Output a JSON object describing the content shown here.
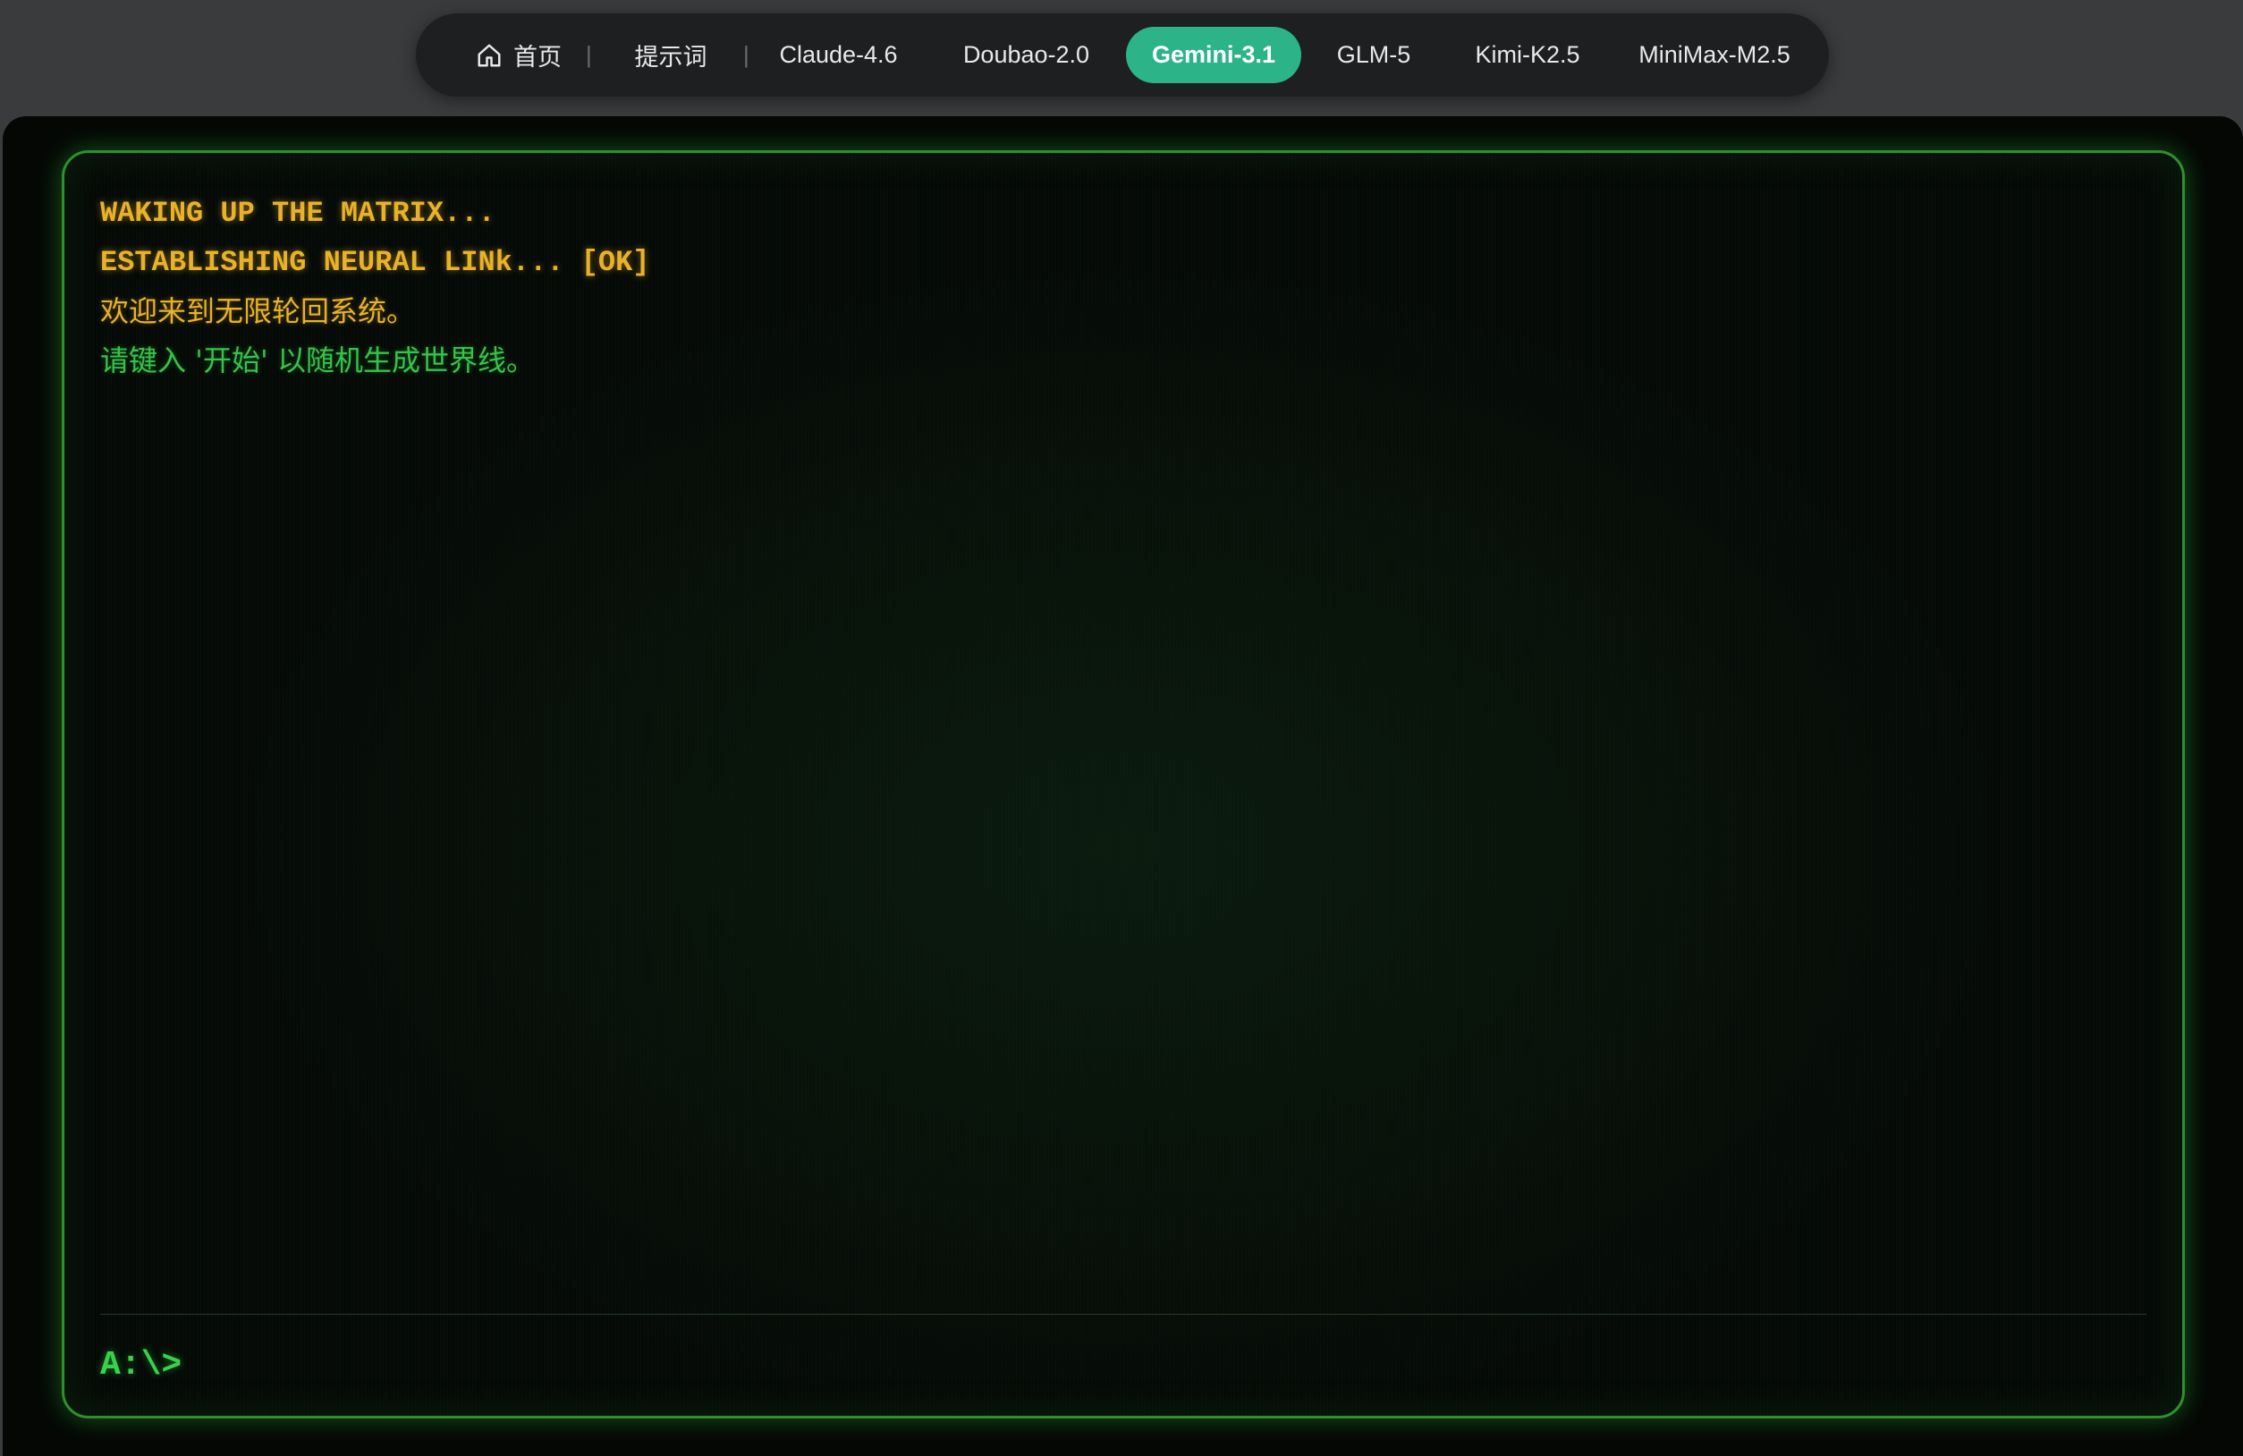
{
  "nav": {
    "home_label": "首页",
    "separator": "|",
    "prompts_label": "提示词",
    "tabs": [
      {
        "label": "Claude-4.6"
      },
      {
        "label": "Doubao-2.0"
      },
      {
        "label": "Gemini-3.1"
      },
      {
        "label": "GLM-5"
      },
      {
        "label": "Kimi-K2.5"
      },
      {
        "label": "MiniMax-M2.5"
      }
    ],
    "active_tab": "Gemini-3.1",
    "active_color": "#2db388"
  },
  "terminal": {
    "lines": [
      {
        "text": "WAKING UP THE MATRIX..."
      },
      {
        "text": "ESTABLISHING NEURAL LINk... [OK]"
      },
      {
        "text": "欢迎来到无限轮回系统。"
      },
      {
        "text": "请键入 '开始' 以随机生成世界线。"
      }
    ],
    "prompt": "A:\\>",
    "input_value": "",
    "colors": {
      "amber": "#e8b12a",
      "green": "#36c24a",
      "border": "#2f8f2f"
    }
  }
}
